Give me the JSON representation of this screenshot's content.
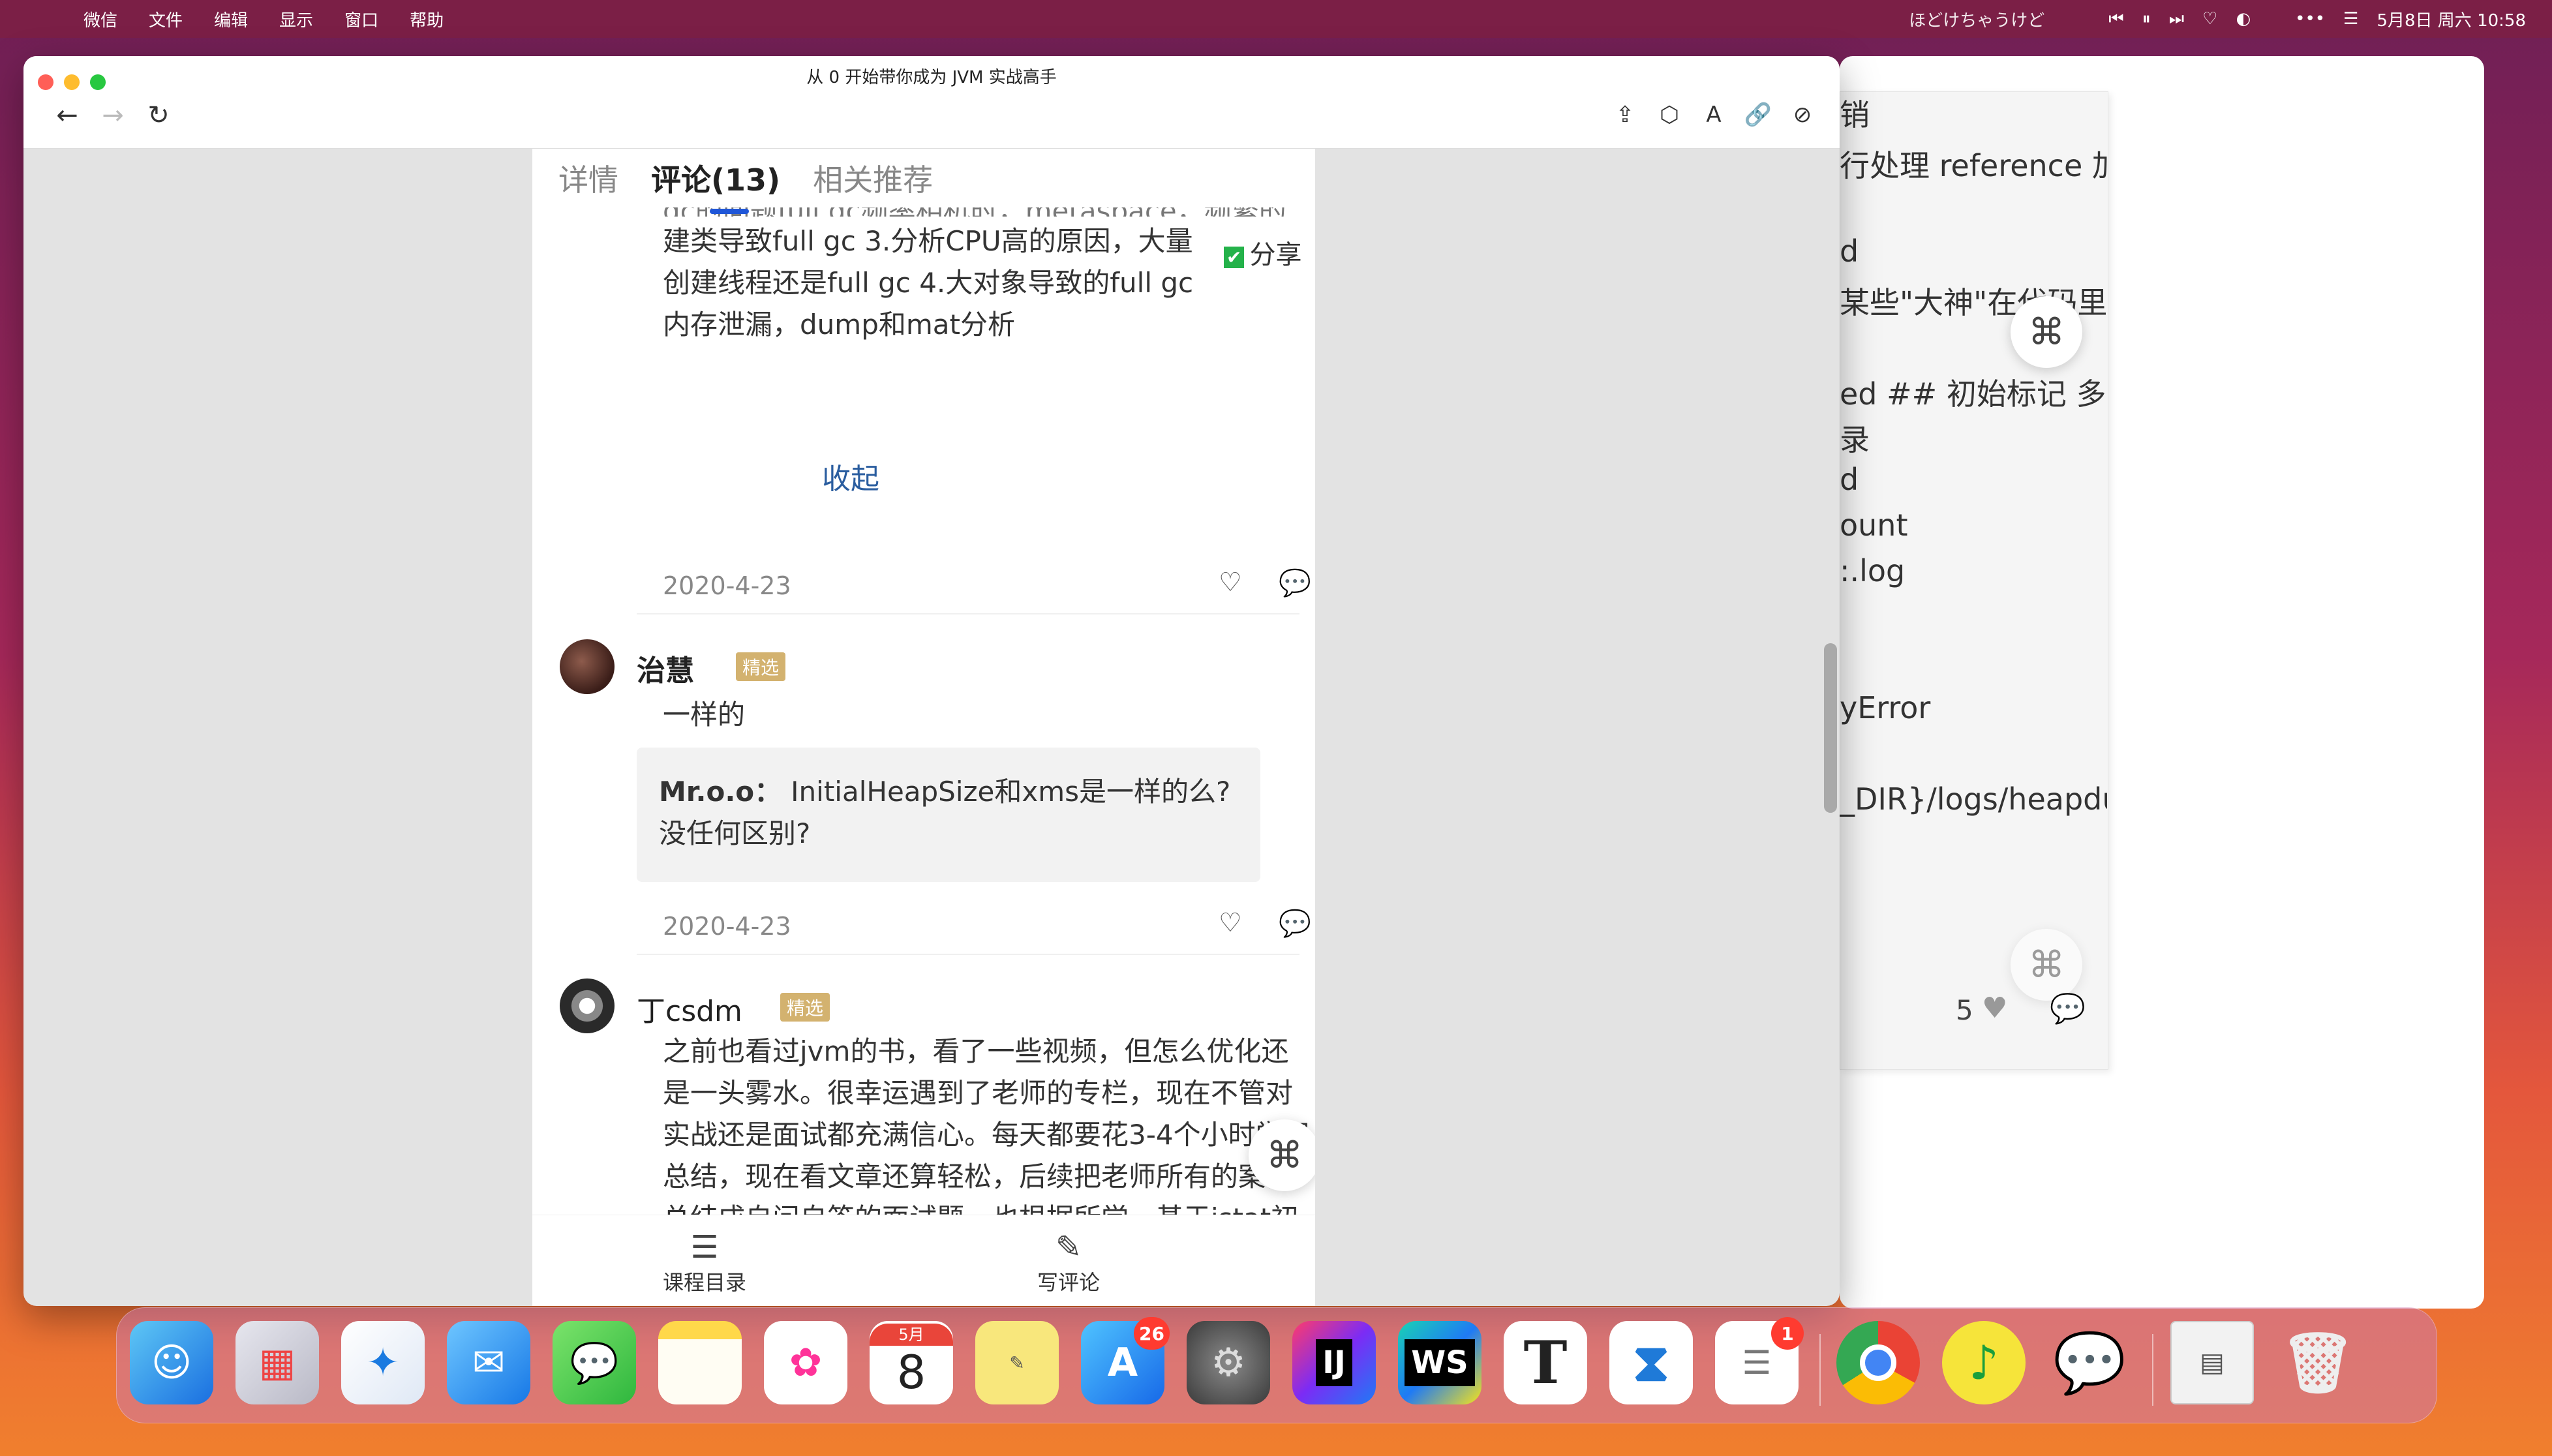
{
  "menubar": {
    "apple": "",
    "items": [
      "微信",
      "文件",
      "编辑",
      "显示",
      "窗口",
      "帮助"
    ],
    "now_playing": "ほどけちゃうけど",
    "datetime": "5月8日 周六 10:58"
  },
  "window": {
    "title": "从 0 开始带你成为 JVM 实战高手"
  },
  "tabs": [
    "详情",
    "评论(13)",
    "相关推荐"
  ],
  "share_label": "分享",
  "comment1": {
    "partial_top": "gc的问题full gc频率相机时，metaspace，频繁的",
    "text": "建类导致full gc  3.分析CPU高的原因，大量创建线程还是full gc  4.大对象导致的full gc内存泄漏，dump和mat分析",
    "collapse": "收起",
    "date": "2020-4-23"
  },
  "comment2": {
    "username": "治慧",
    "badge": "精选",
    "text": "一样的",
    "quote_author": "Mr.o.o：",
    "quote_text": "InitialHeapSize和xms是一样的么?没任何区别?",
    "date": "2020-4-23"
  },
  "comment3": {
    "username": "丁csdm",
    "badge": "精选",
    "text": "之前也看过jvm的书，看了一些视频，但怎么优化还是一头雾水。很幸运遇到了老师的专栏，现在不管对实战还是面试都充满信心。每天都要花3-4个小时学习总结，现在看文章还算轻松，后续把老师所有的案例总结成自问自答的面试题。也根据所学，基于jstat初步做了个监控小工具，后面"
  },
  "bottom_bar": {
    "toc": "课程目录",
    "write": "写评论"
  },
  "background_window": {
    "lines": [
      "销",
      "行处理 reference 加",
      "d",
      "某些\"大神\"在代码里",
      "ed ## 初始标记 多线",
      "录",
      "d",
      "ount",
      ":.log",
      "yError",
      "_DIR}/logs/heapdum"
    ],
    "like_count": "5"
  },
  "dock": {
    "calendar_month": "5月",
    "calendar_day": "8",
    "appstore_badge": "26",
    "reminders_badge": "1",
    "ij_label": "IJ",
    "ws_label": "WS",
    "typora_label": "T"
  }
}
